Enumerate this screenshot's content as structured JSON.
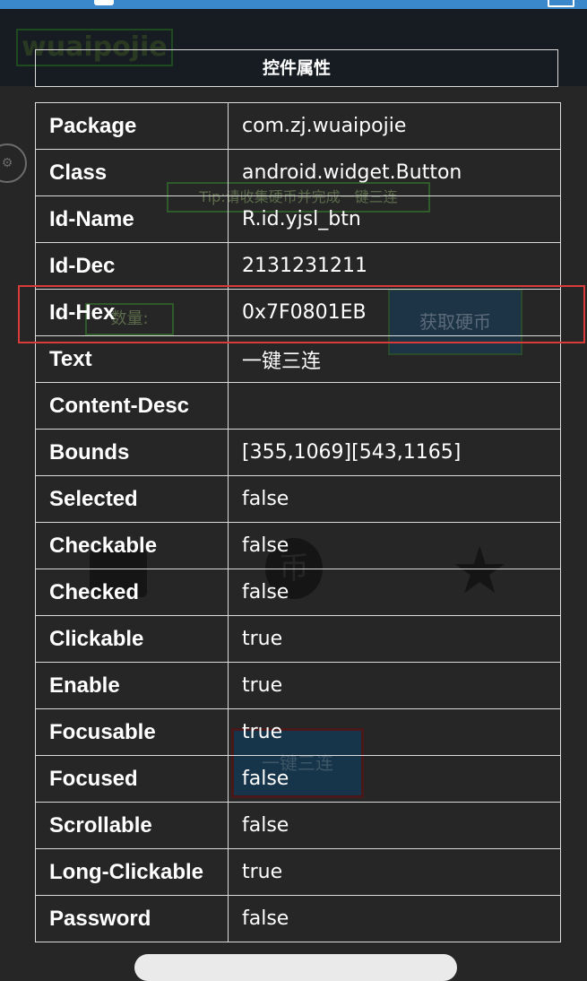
{
  "background_app": {
    "title": "wuaipojie",
    "tip": "Tip:请收集硬币并完成一键三连",
    "count_label": "数量:",
    "get_coin_label": "获取硬币",
    "triple_label": "一键三连",
    "icons": [
      "settings-icon",
      "like-icon",
      "coin-icon",
      "star-icon"
    ]
  },
  "dialog": {
    "title": "控件属性",
    "rows": [
      {
        "key": "Package",
        "value": "com.zj.wuaipojie"
      },
      {
        "key": "Class",
        "value": "android.widget.Button"
      },
      {
        "key": "Id-Name",
        "value": "R.id.yjsl_btn"
      },
      {
        "key": "Id-Dec",
        "value": "2131231211"
      },
      {
        "key": "Id-Hex",
        "value": "0x7F0801EB"
      },
      {
        "key": "Text",
        "value": "一键三连"
      },
      {
        "key": "Content-Desc",
        "value": ""
      },
      {
        "key": "Bounds",
        "value": "[355,1069][543,1165]"
      },
      {
        "key": "Selected",
        "value": "false"
      },
      {
        "key": "Checkable",
        "value": "false"
      },
      {
        "key": "Checked",
        "value": "false"
      },
      {
        "key": "Clickable",
        "value": "true"
      },
      {
        "key": "Enable",
        "value": "true"
      },
      {
        "key": "Focusable",
        "value": "true"
      },
      {
        "key": "Focused",
        "value": "false"
      },
      {
        "key": "Scrollable",
        "value": "false"
      },
      {
        "key": "Long-Clickable",
        "value": "true"
      },
      {
        "key": "Password",
        "value": "false"
      }
    ],
    "highlighted_row": "Id-Hex",
    "highlight_color": "#d93a3a"
  }
}
